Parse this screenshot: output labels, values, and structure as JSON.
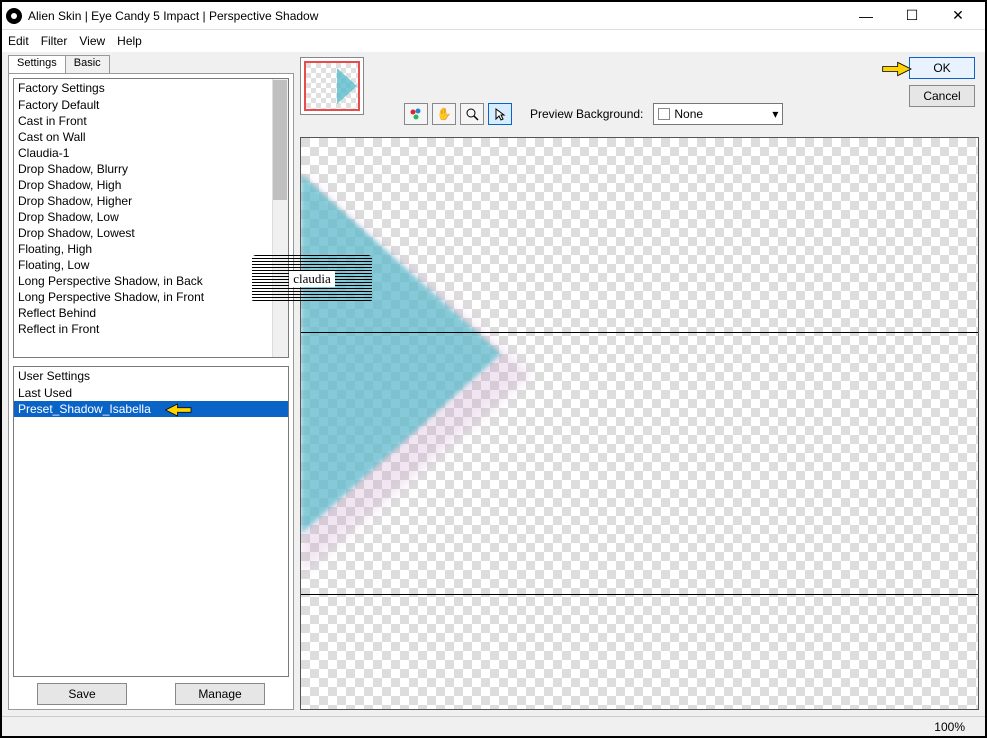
{
  "title": "Alien Skin | Eye Candy 5 Impact | Perspective Shadow",
  "menu": {
    "edit": "Edit",
    "filter": "Filter",
    "view": "View",
    "help": "Help"
  },
  "tabs": {
    "settings": "Settings",
    "basic": "Basic"
  },
  "factory": {
    "header": "Factory Settings",
    "items": [
      "Factory Default",
      "Cast in Front",
      "Cast on Wall",
      "Claudia-1",
      "Drop Shadow, Blurry",
      "Drop Shadow, High",
      "Drop Shadow, Higher",
      "Drop Shadow, Low",
      "Drop Shadow, Lowest",
      "Floating, High",
      "Floating, Low",
      "Long Perspective Shadow, in Back",
      "Long Perspective Shadow, in Front",
      "Reflect Behind",
      "Reflect in Front"
    ]
  },
  "user": {
    "header": "User Settings",
    "items": [
      "Last Used",
      "Preset_Shadow_Isabella"
    ],
    "selected_index": 1
  },
  "buttons": {
    "save": "Save",
    "manage": "Manage",
    "ok": "OK",
    "cancel": "Cancel"
  },
  "preview": {
    "label": "Preview Background:",
    "value": "None"
  },
  "status": {
    "zoom": "100%"
  },
  "watermark": "claudia"
}
